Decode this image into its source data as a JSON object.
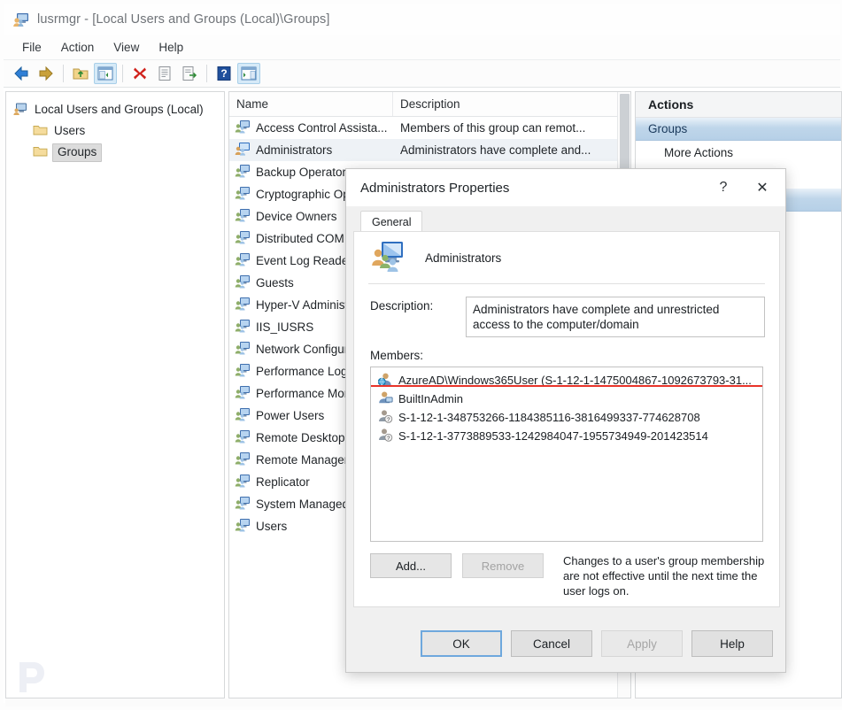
{
  "window": {
    "title": "lusrmgr - [Local Users and Groups (Local)\\Groups]",
    "icon": "computer-users-icon"
  },
  "menubar": {
    "items": [
      {
        "label": "File"
      },
      {
        "label": "Action"
      },
      {
        "label": "View"
      },
      {
        "label": "Help"
      }
    ]
  },
  "toolbar": {
    "buttons": [
      {
        "name": "back-arrow-icon",
        "tooltip": "Back"
      },
      {
        "name": "forward-arrow-icon",
        "tooltip": "Forward"
      },
      {
        "name": "up-folder-icon",
        "tooltip": "Up One Level"
      },
      {
        "name": "show-hide-tree-icon",
        "tooltip": "Show/Hide Console Tree"
      },
      {
        "name": "delete-x-icon",
        "tooltip": "Delete"
      },
      {
        "name": "properties-icon",
        "tooltip": "Properties"
      },
      {
        "name": "export-list-icon",
        "tooltip": "Export List"
      },
      {
        "name": "help-question-icon",
        "tooltip": "Help"
      },
      {
        "name": "show-hide-action-pane-icon",
        "tooltip": "Show/Hide Action Pane"
      }
    ]
  },
  "tree": {
    "root": {
      "label": "Local Users and Groups (Local)"
    },
    "children": [
      {
        "label": "Users",
        "selected": false
      },
      {
        "label": "Groups",
        "selected": true
      }
    ]
  },
  "list": {
    "columns": [
      "Name",
      "Description"
    ],
    "rows": [
      {
        "name": "Access Control Assista...",
        "description": "Members of this group can remot...",
        "selected": false
      },
      {
        "name": "Administrators",
        "description": "Administrators have complete and...",
        "selected": true
      },
      {
        "name": "Backup Operators",
        "description": "",
        "selected": false
      },
      {
        "name": "Cryptographic Operators",
        "description": "",
        "selected": false
      },
      {
        "name": "Device Owners",
        "description": "",
        "selected": false
      },
      {
        "name": "Distributed COM Users",
        "description": "",
        "selected": false
      },
      {
        "name": "Event Log Readers",
        "description": "",
        "selected": false
      },
      {
        "name": "Guests",
        "description": "",
        "selected": false
      },
      {
        "name": "Hyper-V Administrators",
        "description": "",
        "selected": false
      },
      {
        "name": "IIS_IUSRS",
        "description": "",
        "selected": false
      },
      {
        "name": "Network Configuration",
        "description": "",
        "selected": false
      },
      {
        "name": "Performance Log Users",
        "description": "",
        "selected": false
      },
      {
        "name": "Performance Monitor Users",
        "description": "",
        "selected": false
      },
      {
        "name": "Power Users",
        "description": "",
        "selected": false
      },
      {
        "name": "Remote Desktop Users",
        "description": "",
        "selected": false
      },
      {
        "name": "Remote Management Users",
        "description": "",
        "selected": false
      },
      {
        "name": "Replicator",
        "description": "",
        "selected": false
      },
      {
        "name": "System Managed Accounts",
        "description": "",
        "selected": false
      },
      {
        "name": "Users",
        "description": "",
        "selected": false
      }
    ]
  },
  "actions": {
    "title": "Actions",
    "groups": [
      {
        "header": "Groups",
        "items": [
          {
            "label": "More Actions"
          }
        ]
      },
      {
        "header": "",
        "items": []
      }
    ]
  },
  "dialog": {
    "title": "Administrators Properties",
    "help_button": "?",
    "close_button": "✕",
    "tabs": [
      {
        "label": "General",
        "active": true
      }
    ],
    "group_name": "Administrators",
    "group_icon": "group-computer-icon",
    "description_label": "Description:",
    "description_value": "Administrators have complete and unrestricted access to the computer/domain",
    "members_label": "Members:",
    "members": [
      {
        "text": "AzureAD\\Windows365User (S-1-12-1-1475004867-1092673793-31...",
        "icon": "azuread-user-icon",
        "highlighted": true
      },
      {
        "text": "BuiltInAdmin",
        "icon": "local-user-icon",
        "highlighted": false
      },
      {
        "text": "S-1-12-1-348753266-1184385116-3816499337-774628708",
        "icon": "unknown-sid-icon",
        "highlighted": false
      },
      {
        "text": "S-1-12-1-3773889533-1242984047-1955734949-201423514",
        "icon": "unknown-sid-icon",
        "highlighted": false
      }
    ],
    "add_button": "Add...",
    "remove_button": "Remove",
    "remove_disabled": true,
    "hint": "Changes to a user's group membership are not effective until the next time the user logs on.",
    "footer": [
      {
        "label": "OK",
        "style": "default"
      },
      {
        "label": "Cancel",
        "style": "normal"
      },
      {
        "label": "Apply",
        "style": "disabled"
      },
      {
        "label": "Help",
        "style": "normal"
      }
    ]
  },
  "colors": {
    "highlight_red": "#e8342a",
    "actions_header_blue": "#bfd6ea",
    "default_button_border": "#6ea8dd"
  }
}
